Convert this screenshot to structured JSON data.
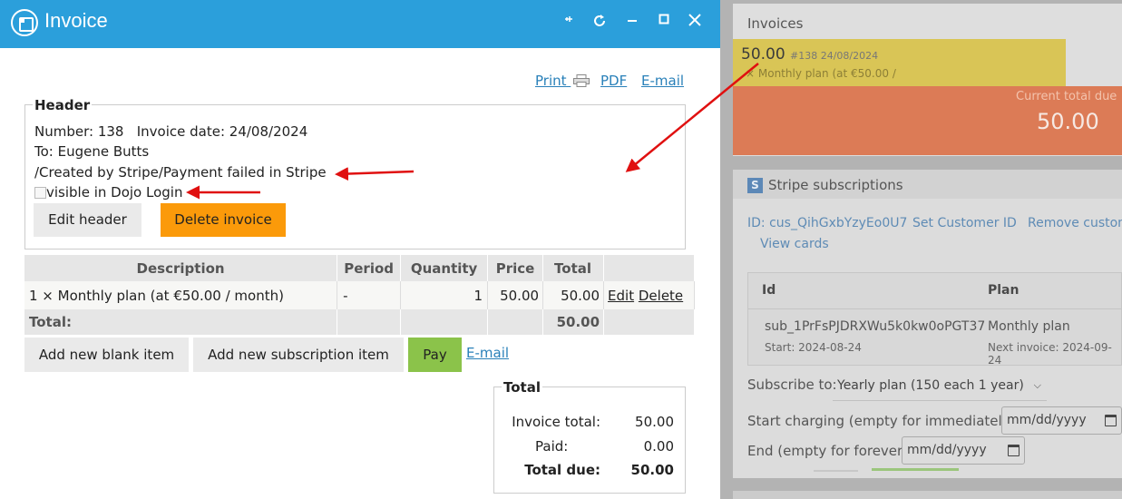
{
  "window": {
    "title": "Invoice"
  },
  "toolbar": {
    "print": "Print",
    "pdf": "PDF",
    "email": "E-mail"
  },
  "header": {
    "legend": "Header",
    "number_line": "Number: 138   Invoice date: 24/08/2024",
    "to_line": "To: Eugene Butts",
    "note_line": "/Created by Stripe/Payment failed in Stripe",
    "visible_label": "visible in Dojo Login",
    "visible_checked": false,
    "edit_button": "Edit header",
    "delete_button": "Delete invoice"
  },
  "items": {
    "columns": [
      "Description",
      "Period",
      "Quantity",
      "Price",
      "Total",
      ""
    ],
    "rows": [
      {
        "description": "1 × Monthly plan (at €50.00 / month)",
        "period": "-",
        "quantity": "1",
        "price": "50.00",
        "total": "50.00",
        "edit": "Edit",
        "delete": "Delete"
      }
    ],
    "total_label": "Total:",
    "total_value": "50.00"
  },
  "actions": {
    "add_blank": "Add new blank item",
    "add_subscription": "Add new subscription item",
    "pay": "Pay",
    "email": "E-mail"
  },
  "totals": {
    "legend": "Total",
    "invoice_total_label": "Invoice total:",
    "invoice_total_value": "50.00",
    "paid_label": "Paid:",
    "paid_value": "0.00",
    "due_label": "Total due:",
    "due_value": "50.00"
  },
  "side": {
    "invoices_title": "Invoices",
    "invoice_amount": "50.00",
    "invoice_meta": "#138 24/08/2024",
    "invoice_desc": "× Monthly plan (at €50.00 /",
    "current_due_label": "Current total due",
    "current_due_value": "50.00",
    "stripe_title": "Stripe subscriptions",
    "stripe_logo": "S",
    "customer_id": "ID: cus_QihGxbYzyEo0U7",
    "set_customer": "Set Customer ID",
    "remove_customer": "Remove customer",
    "view_cards": "View cards",
    "sub_col_id": "Id",
    "sub_col_plan": "Plan",
    "sub_id": "sub_1PrFsPJDRXWu5k0kw0oPGT37",
    "sub_start": "Start: 2024-08-24",
    "sub_plan": "Monthly plan",
    "sub_next": "Next invoice: 2024-09-24",
    "subscribe_label": "Subscribe to:",
    "subscribe_value": "Yearly plan (150 each 1 year)",
    "start_label": "Start charging (empty for immediately):",
    "end_label": "End (empty for forever):",
    "date_placeholder": "mm/dd/yyyy"
  },
  "colors": {
    "titlebar": "#2b9fdb",
    "delete_button": "#fb9a0a",
    "pay_button": "#8bc34a",
    "link": "#2980b9",
    "annotation_arrow": "#e01010"
  }
}
